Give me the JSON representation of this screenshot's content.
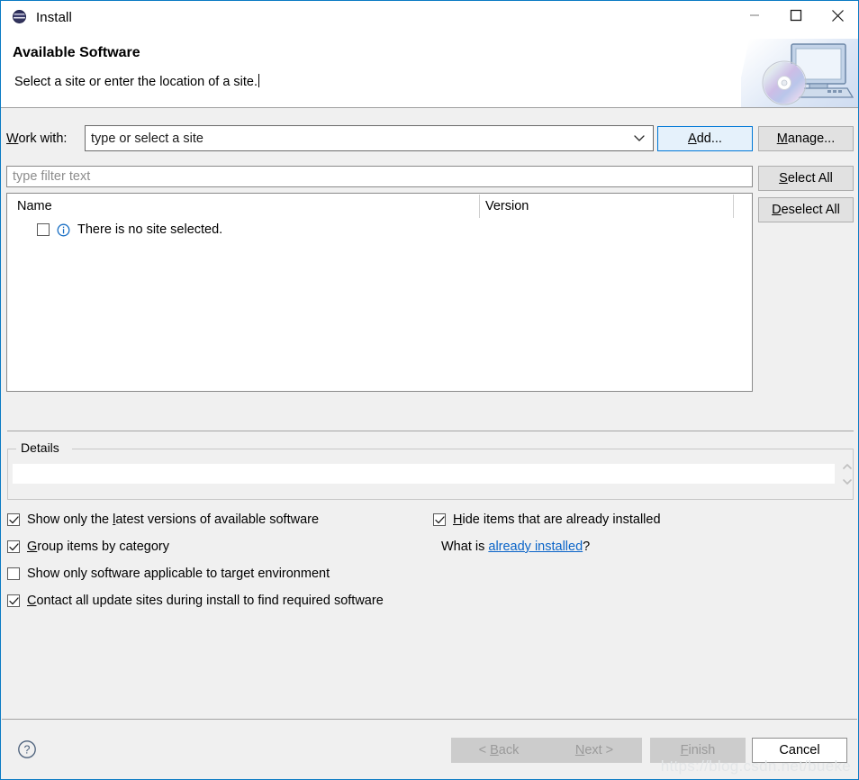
{
  "window": {
    "title": "Install",
    "icon": "eclipse-sphere-icon",
    "border_color": "#0a7bc4",
    "controls": {
      "minimize": "minimize-icon",
      "maximize": "maximize-icon",
      "close": "close-icon"
    }
  },
  "header": {
    "title": "Available Software",
    "subtitle": "Select a site or enter the location of a site.",
    "artwork": "computer-with-cd-icon"
  },
  "work_with": {
    "label": "Work with:",
    "label_mnemonic": "W",
    "combo_value": "type or select a site",
    "combo_arrow": "chevron-down-icon"
  },
  "side_buttons": [
    {
      "name": "add-button",
      "label": "Add...",
      "mnemonic": "A",
      "default": true,
      "enabled": true
    },
    {
      "name": "manage-button",
      "label": "Manage...",
      "mnemonic": "M",
      "default": false,
      "enabled": true
    },
    {
      "name": "select-all-button",
      "label": "Select All",
      "mnemonic": "S",
      "default": false,
      "enabled": true
    },
    {
      "name": "deselect-all-button",
      "label": "Deselect All",
      "mnemonic": "D",
      "default": false,
      "enabled": true
    }
  ],
  "filter": {
    "placeholder": "type filter text",
    "value": ""
  },
  "table": {
    "columns": [
      "Name",
      "Version"
    ],
    "rows": [
      {
        "checked": false,
        "icon": "info-icon",
        "name": "There is no site selected.",
        "version": ""
      }
    ]
  },
  "details": {
    "legend": "Details",
    "value": "",
    "spinner": "updown-arrows-icon"
  },
  "options": {
    "left": [
      {
        "label": "Show only the latest versions of available software",
        "checked": true,
        "mnemonic": "l",
        "mnemonic_index": 15
      },
      {
        "label": "Group items by category",
        "checked": true,
        "mnemonic": "G",
        "mnemonic_index": 0
      },
      {
        "label": "Show only software applicable to target environment",
        "checked": false,
        "mnemonic": "",
        "mnemonic_index": -1
      },
      {
        "label": "Contact all update sites during install to find required software",
        "checked": true,
        "mnemonic": "C",
        "mnemonic_index": 0
      }
    ],
    "right": [
      {
        "label": "Hide items that are already installed",
        "checked": true,
        "mnemonic": "H",
        "mnemonic_index": 0
      }
    ],
    "whatis": {
      "prefix": "What is ",
      "link": "already installed",
      "suffix": "?"
    }
  },
  "footer": {
    "help": "help-icon",
    "buttons": [
      {
        "name": "back-button",
        "label": "< Back",
        "enabled": false
      },
      {
        "name": "next-button",
        "label": "Next >",
        "enabled": false
      },
      {
        "name": "finish-button",
        "label": "Finish",
        "enabled": false
      },
      {
        "name": "cancel-button",
        "label": "Cancel",
        "enabled": true
      }
    ]
  },
  "watermark": "https://blog.csdn.net/bueke"
}
